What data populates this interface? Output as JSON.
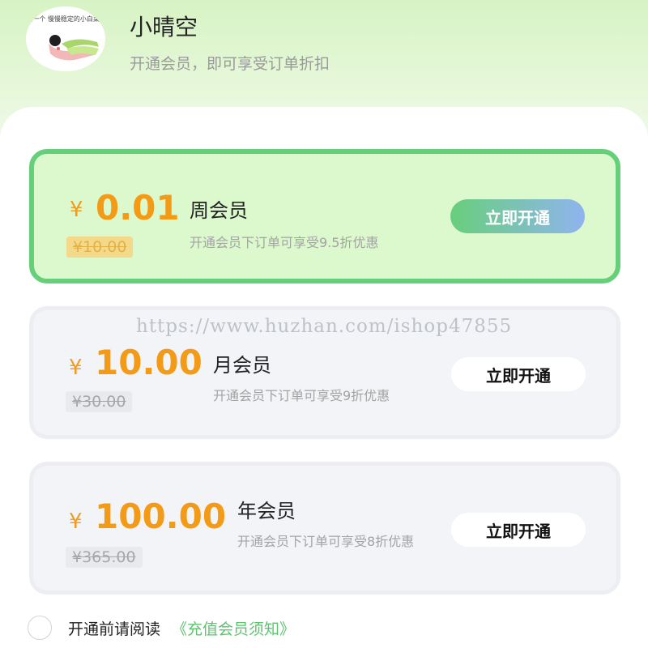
{
  "header": {
    "username": "小晴空",
    "subtitle": "开通会员，即可享受订单折扣",
    "avatar_caption": "做一个 慢慢稳定的小白菜~"
  },
  "plans": [
    {
      "currency": "¥",
      "price": "0.01",
      "original_price": "¥10.00",
      "name": "周会员",
      "description": "开通会员下订单可享受9.5折优惠",
      "button_label": "立即开通",
      "selected": true
    },
    {
      "currency": "¥",
      "price": "10.00",
      "original_price": "¥30.00",
      "name": "月会员",
      "description": "开通会员下订单可享受9折优惠",
      "button_label": "立即开通",
      "selected": false
    },
    {
      "currency": "¥",
      "price": "100.00",
      "original_price": "¥365.00",
      "name": "年会员",
      "description": "开通会员下订单可享受8折优惠",
      "button_label": "立即开通",
      "selected": false
    }
  ],
  "watermark": "https://www.huzhan.com/ishop47855",
  "agreement": {
    "prefix": "开通前请阅读",
    "link_label": "《充值会员须知》",
    "checked": false
  },
  "colors": {
    "accent_green": "#66cf79",
    "price_orange": "#f39a16",
    "link_green": "#5bc46e"
  }
}
